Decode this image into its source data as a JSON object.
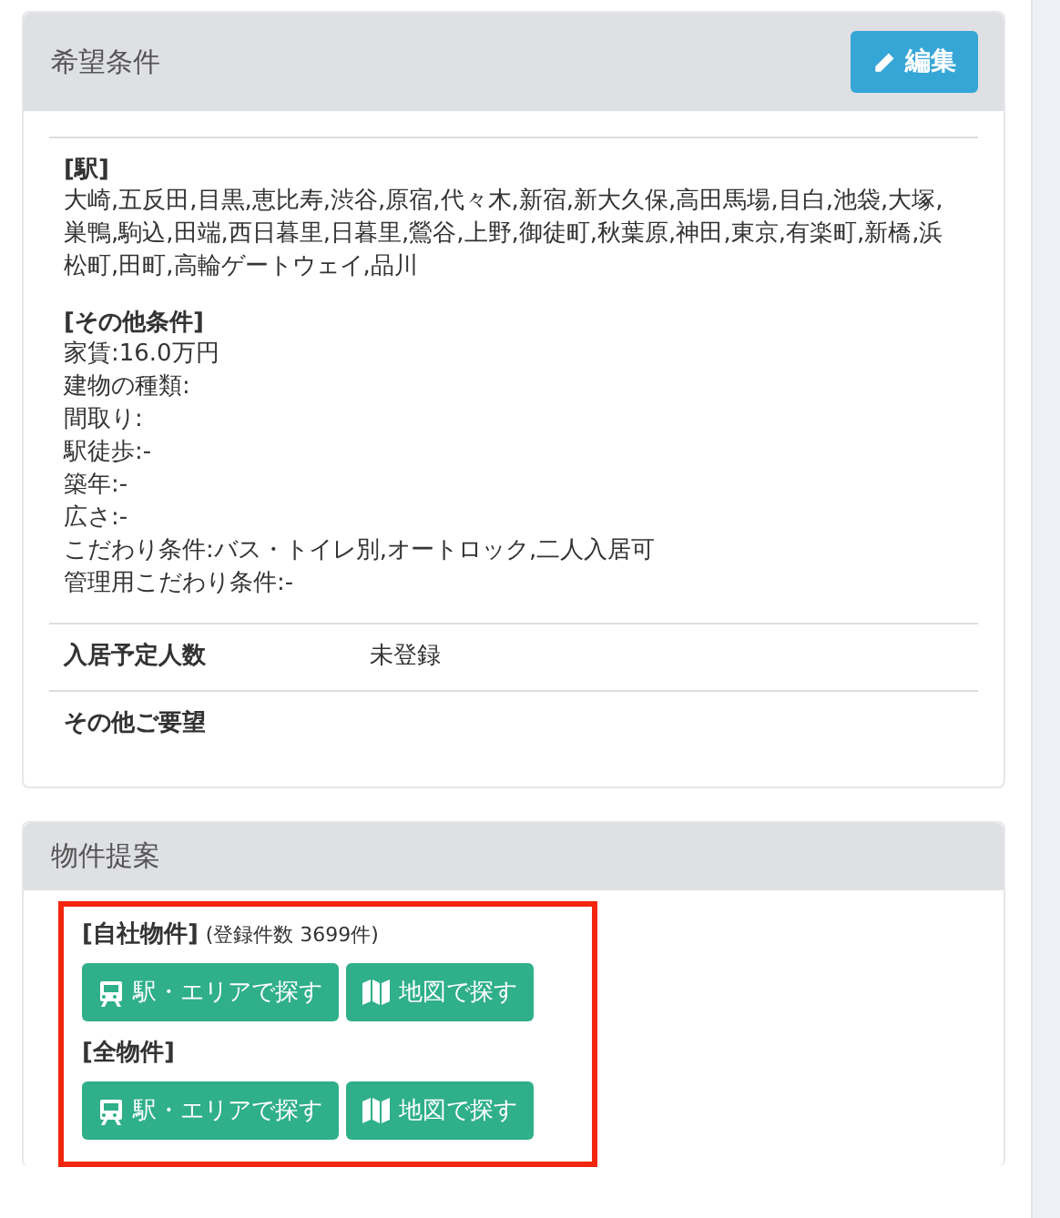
{
  "conditions_panel": {
    "title": "希望条件",
    "edit_button": "編集",
    "stations": {
      "heading": "[駅]",
      "text": "大崎,五反田,目黒,恵比寿,渋谷,原宿,代々木,新宿,新大久保,高田馬場,目白,池袋,大塚,巣鴨,駒込,田端,西日暮里,日暮里,鶯谷,上野,御徒町,秋葉原,神田,東京,有楽町,新橋,浜松町,田町,高輪ゲートウェイ,品川"
    },
    "other": {
      "heading": "[その他条件]",
      "lines": [
        "家賃:16.0万円",
        "建物の種類:",
        "間取り:",
        "駅徒歩:-",
        "築年:-",
        "広さ:-",
        "こだわり条件:バス・トイレ別,オートロック,二人入居可",
        "管理用こだわり条件:-"
      ]
    },
    "rows": [
      {
        "label": "入居予定人数",
        "value": "未登録"
      },
      {
        "label": "その他ご要望"
      }
    ]
  },
  "proposal_panel": {
    "title": "物件提案",
    "highlighted": true,
    "groups": [
      {
        "heading": "[自社物件]",
        "note": "(登録件数 3699件)",
        "buttons": [
          {
            "kind": "train",
            "label": "駅・エリアで探す"
          },
          {
            "kind": "map",
            "label": "地図で探す"
          }
        ]
      },
      {
        "heading": "[全物件]",
        "buttons": [
          {
            "kind": "train",
            "label": "駅・エリアで探す"
          },
          {
            "kind": "map",
            "label": "地図で探す"
          }
        ]
      }
    ]
  }
}
